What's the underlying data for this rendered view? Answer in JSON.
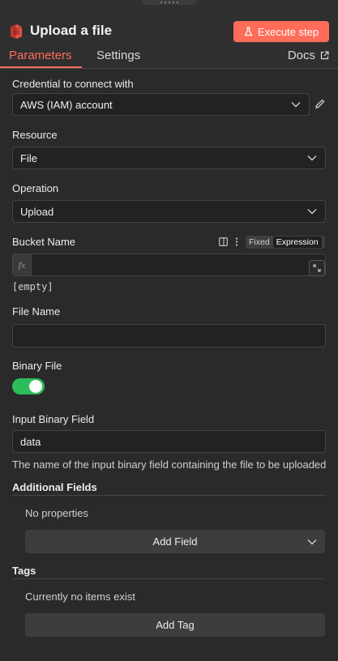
{
  "header": {
    "title": "Upload a file",
    "execute_label": "Execute step"
  },
  "tabs": [
    {
      "label": "Parameters",
      "active": true
    },
    {
      "label": "Settings",
      "active": false
    }
  ],
  "docs_label": "Docs",
  "credential": {
    "label": "Credential to connect with",
    "value": "AWS (IAM) account"
  },
  "resource": {
    "label": "Resource",
    "value": "File"
  },
  "operation": {
    "label": "Operation",
    "value": "Upload"
  },
  "bucket": {
    "label": "Bucket Name",
    "mode_fixed": "Fixed",
    "mode_expression": "Expression",
    "fx": "fx",
    "value": "",
    "empty_hint": "[empty]"
  },
  "file_name": {
    "label": "File Name",
    "value": ""
  },
  "binary_file": {
    "label": "Binary File",
    "enabled": true
  },
  "input_binary": {
    "label": "Input Binary Field",
    "value": "data",
    "hint": "The name of the input binary field containing the file to be uploaded"
  },
  "additional_fields": {
    "label": "Additional Fields",
    "empty_text": "No properties",
    "button": "Add Field"
  },
  "tags": {
    "label": "Tags",
    "empty_text": "Currently no items exist",
    "button": "Add Tag"
  },
  "colors": {
    "accent": "#ff6d5a",
    "toggle_on": "#2dbd5a"
  }
}
